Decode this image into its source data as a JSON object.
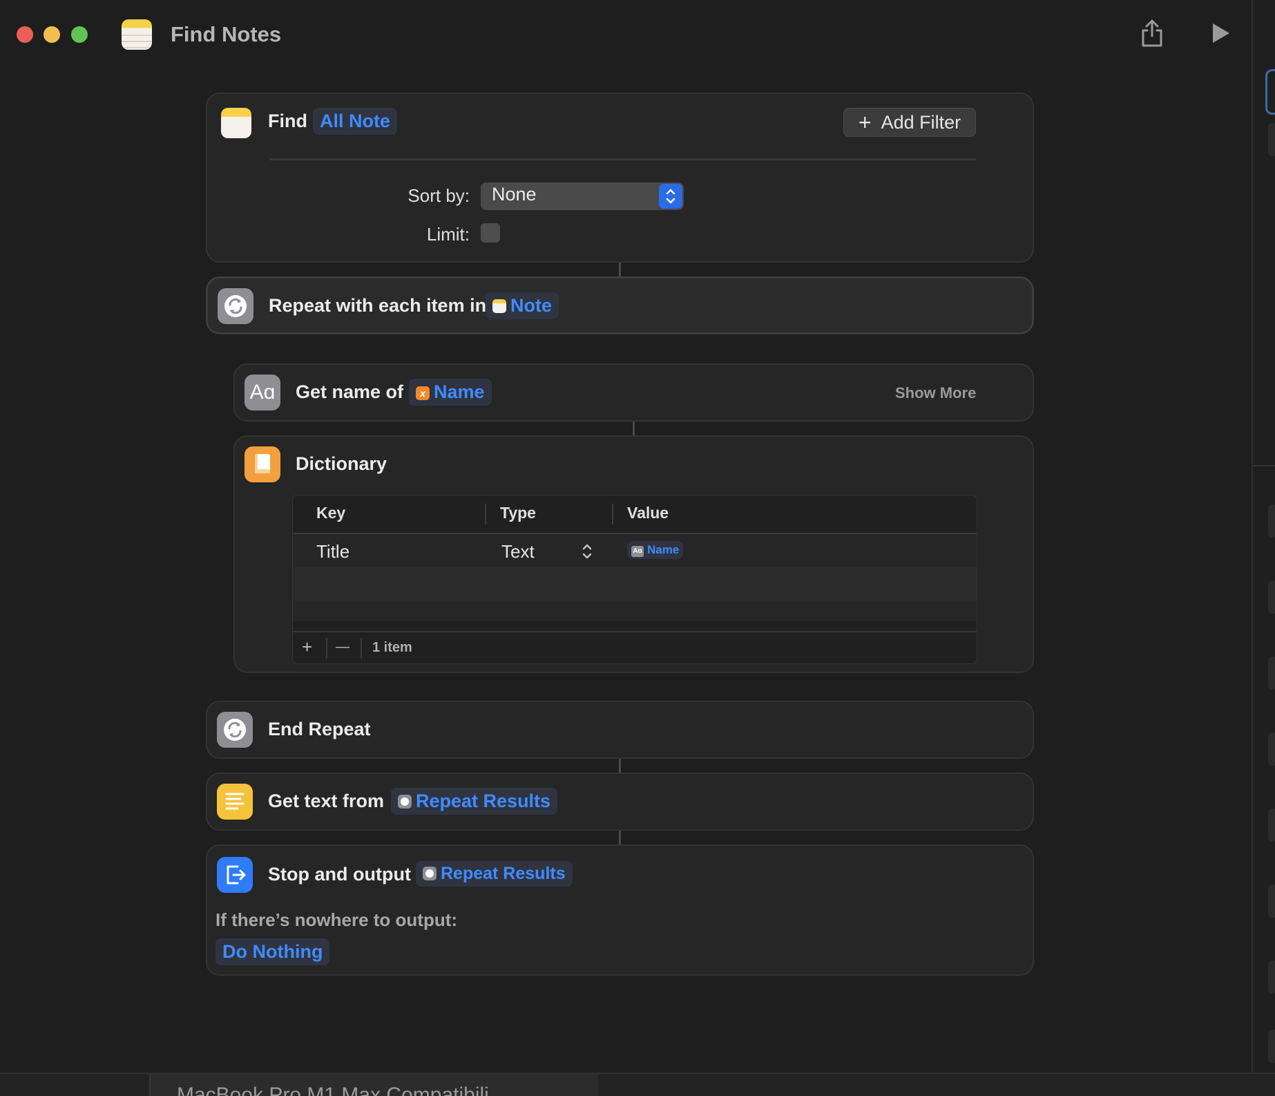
{
  "window": {
    "title": "Find Notes"
  },
  "find_action": {
    "verb": "Find",
    "token": "All Note",
    "add_filter_label": "Add Filter",
    "sort_by_label": "Sort by:",
    "sort_by_value": "None",
    "limit_label": "Limit:"
  },
  "repeat_action": {
    "label": "Repeat with each item in",
    "token": "Note"
  },
  "get_name_action": {
    "label": "Get name of",
    "token": "Name",
    "show_more": "Show More"
  },
  "dictionary_action": {
    "label": "Dictionary",
    "columns": [
      "Key",
      "Type",
      "Value"
    ],
    "rows": [
      {
        "key": "Title",
        "type": "Text",
        "value": "Name"
      }
    ],
    "add_symbol": "+",
    "remove_symbol": "—",
    "count_label": "1 item"
  },
  "end_repeat_action": {
    "label": "End Repeat"
  },
  "get_text_action": {
    "label": "Get text from",
    "token": "Repeat Results"
  },
  "stop_output_action": {
    "label": "Stop and output",
    "token": "Repeat Results",
    "fallback_label": "If there’s nowhere to output:",
    "fallback_value": "Do Nothing"
  },
  "background": {
    "cut_off_text": "MacBook Pro M1 Max Compatibili"
  },
  "colors": {
    "accent_blue": "#3f8cff",
    "notes_yellow": "#f7d149",
    "dictionary_orange": "#f2a03d",
    "stop_blue": "#2f7cf6",
    "variable_orange": "#f08a2c"
  },
  "icons": [
    "notes-app-icon",
    "share-icon",
    "play-icon",
    "repeat-icon",
    "text-aa-icon",
    "dictionary-icon",
    "text-lines-icon",
    "exit-icon",
    "variable-icon"
  ]
}
